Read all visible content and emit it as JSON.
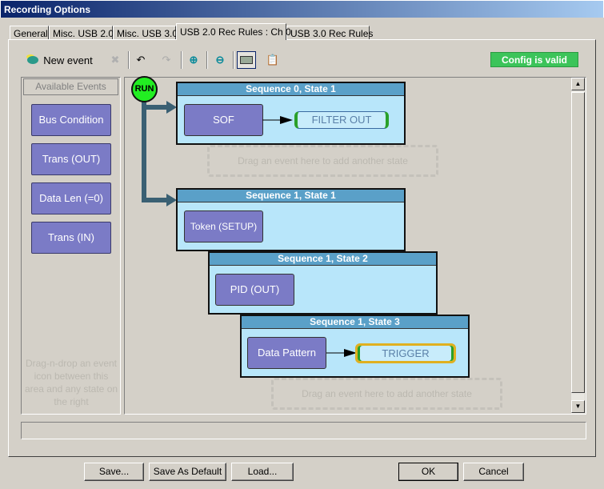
{
  "window": {
    "title": "Recording Options"
  },
  "tabs": [
    {
      "label": "General",
      "active": false
    },
    {
      "label": "Misc. USB 2.0",
      "active": false
    },
    {
      "label": "Misc. USB 3.0",
      "active": false
    },
    {
      "label": "USB 2.0 Rec Rules : Ch 0",
      "active": true
    },
    {
      "label": "USB 3.0 Rec Rules",
      "active": false
    }
  ],
  "toolbar": {
    "new_event": "New event",
    "icons": [
      "new-event-icon",
      "delete-icon",
      "undo-icon",
      "redo-icon",
      "zoom-in-icon",
      "zoom-out-icon",
      "keyboard-icon",
      "properties-icon"
    ],
    "status_badge": "Config is valid",
    "status_color": "#3cc45a"
  },
  "left_panel": {
    "header": "Available Events",
    "events": [
      "Bus Condition",
      "Trans (OUT)",
      "Data Len (=0)",
      "Trans (IN)"
    ],
    "hint": "Drag-n-drop an event icon between this area and any state on the right"
  },
  "canvas": {
    "run_label": "RUN",
    "states": [
      {
        "title": "Sequence 0, State 1",
        "event": "SOF",
        "action": "FILTER OUT"
      },
      {
        "title": "Sequence 1, State 1",
        "event": "Token (SETUP)"
      },
      {
        "title": "Sequence 1, State 2",
        "event": "PID (OUT)"
      },
      {
        "title": "Sequence 1, State 3",
        "event": "Data Pattern",
        "action": "TRIGGER"
      }
    ],
    "drop_hint": "Drag an event here to add another state"
  },
  "buttons": {
    "save": "Save...",
    "save_default": "Save As Default",
    "load": "Load...",
    "ok": "OK",
    "cancel": "Cancel"
  }
}
